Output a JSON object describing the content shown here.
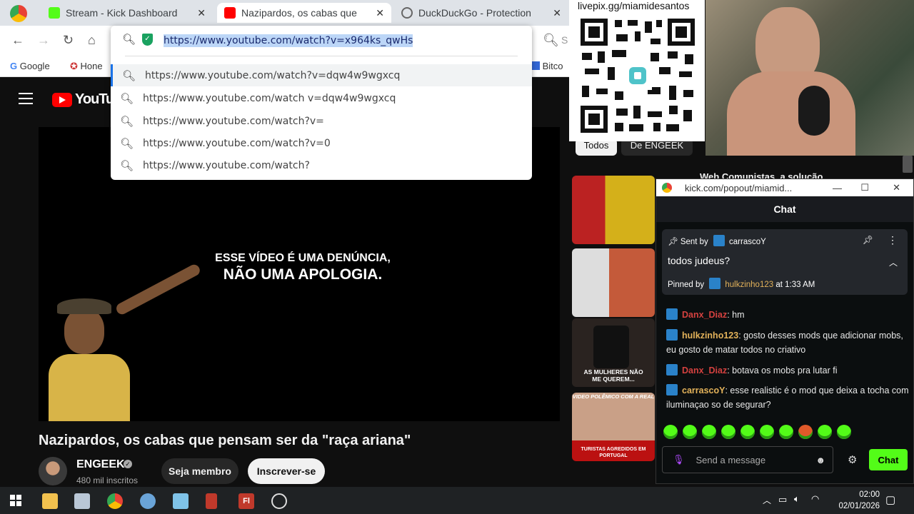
{
  "browser": {
    "tabs": [
      {
        "title": "Stream - Kick Dashboard"
      },
      {
        "title": "Nazipardos, os cabas que"
      },
      {
        "title": "DuckDuckGo - Protection"
      }
    ],
    "omnibox": {
      "url": "https://www.youtube.com/watch?v=x964ks_qwHs",
      "suggestions": [
        "https://www.youtube.com/watch?v=dqw4w9wgxcq",
        "https://www.youtube.com/watch v=dqw4w9wgxcq",
        "https://www.youtube.com/watch?v=",
        "https://www.youtube.com/watch?v=0",
        "https://www.youtube.com/watch?"
      ]
    },
    "bookmarks": [
      {
        "label": "Google"
      },
      {
        "label": "Hone"
      },
      {
        "label": "Bitco"
      }
    ],
    "right_search_fragment": "S"
  },
  "youtube": {
    "logo_text": "YouTub",
    "video_overlay_line1": "ESSE VÍDEO É UMA DENÚNCIA,",
    "video_overlay_line2": "NÃO UMA APOLOGIA.",
    "title": "Nazipardos, os cabas que pensam ser da \"raça ariana\"",
    "channel": {
      "name": "ENGEEK",
      "subscribers": "480 mil inscritos"
    },
    "buttons": {
      "member": "Seja membro",
      "subscribe": "Inscrever-se"
    },
    "chips": [
      "Todos",
      "De ENGEEK"
    ],
    "related_title_fragment": "Web Comunistas, a solução",
    "thumb_captions": [
      "AS MULHERES NÃO ME QUEREM...",
      "TURISTAS AGREDIDOS EM PORTUGAL",
      "VIDEO POLÊMICO COM A REAL"
    ]
  },
  "livepix": {
    "label": "livepix.gg/miamidesantos"
  },
  "kick_popout": {
    "window_title": "kick.com/popout/miamid...",
    "header": "Chat",
    "pinned": {
      "sent_by_label": "Sent by",
      "sender": "carrascoY",
      "message": "todos judeus?",
      "pinned_by_label": "Pinned by",
      "pinned_by": "hulkzinho123",
      "time": "at 1:33 AM"
    },
    "messages": [
      {
        "user": "Danx_Diaz",
        "text": ": hm",
        "color": "red"
      },
      {
        "user": "hulkzinho123",
        "text": ": gosto desses mods que adicionar mobs, eu gosto de matar todos no criativo",
        "color": "gold"
      },
      {
        "user": "Danx_Diaz",
        "text": ": botava os mobs pra lutar fi",
        "color": "red"
      },
      {
        "user": "carrascoY",
        "text": ": esse realistic é o mod que deixa a tocha com iluminaçao so de segurar?",
        "color": "gold"
      }
    ],
    "input_placeholder": "Send a message",
    "send_button": "Chat",
    "accent": "#53fc18"
  },
  "taskbar": {
    "time": "02:00",
    "date": "02/01/2026"
  }
}
